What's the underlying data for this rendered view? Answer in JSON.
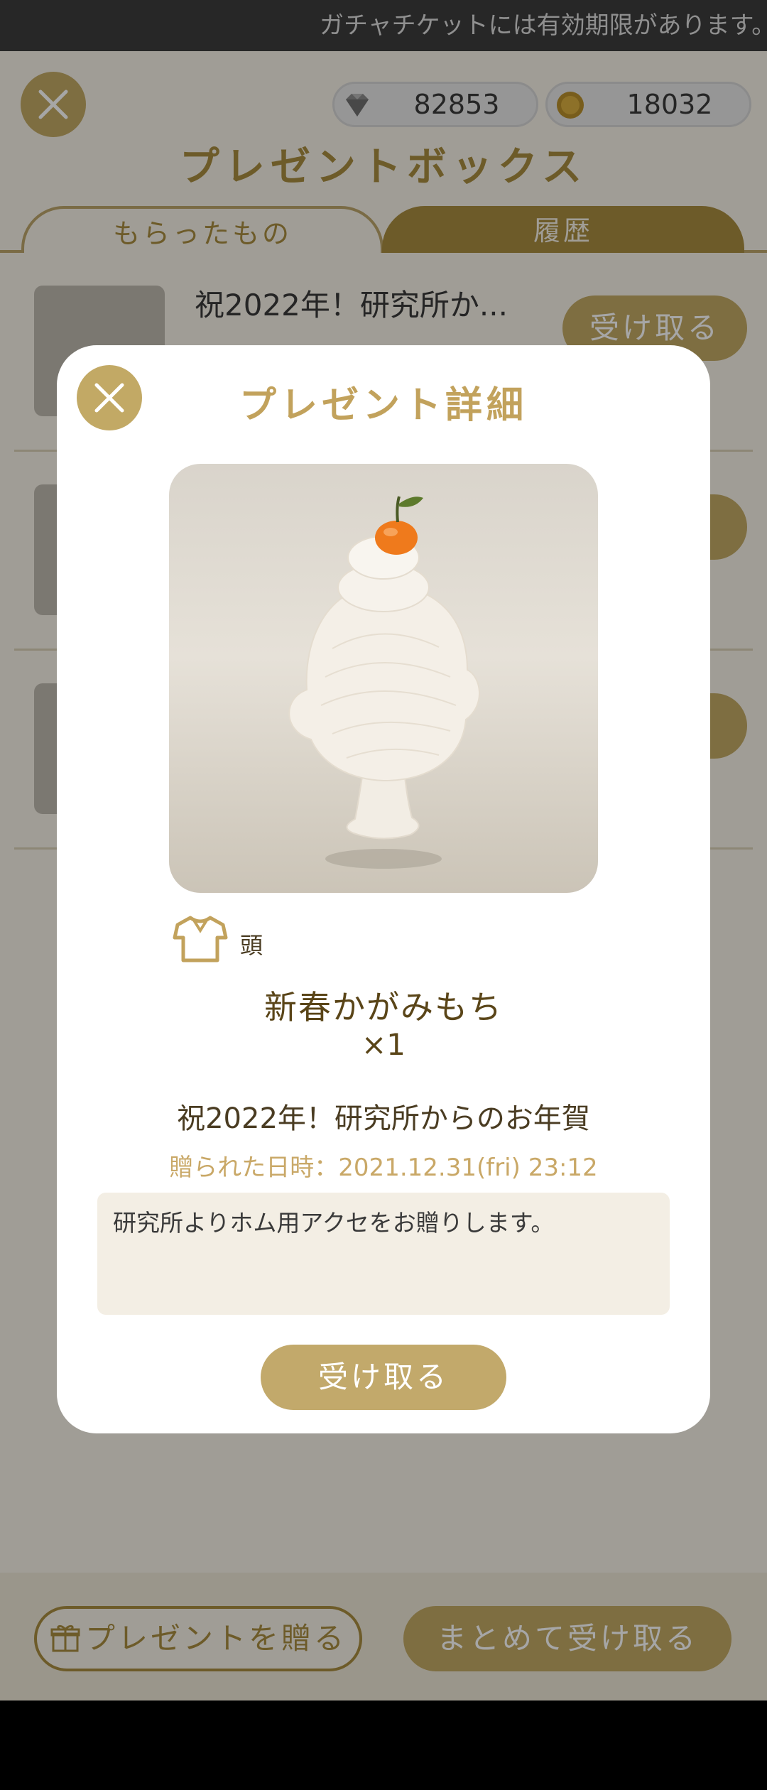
{
  "ticker": {
    "text": "ガチャチケットには有効期限があります。"
  },
  "currencies": {
    "gems": "82853",
    "coins": "18032"
  },
  "header": {
    "title": "プレゼントボックス"
  },
  "tabs": [
    {
      "label": "もらったもの"
    },
    {
      "label": "履歴"
    }
  ],
  "list": {
    "items": [
      {
        "title": "祝2022年！研究所か...",
        "button": "受け取る"
      }
    ]
  },
  "footer": {
    "gift_label": "プレゼントを贈る",
    "bulk_label": "まとめて受け取る"
  },
  "modal": {
    "title": "プレゼント詳細",
    "slot_label": "頭",
    "item_name": "新春かがみもち",
    "quantity": "×1",
    "message_title": "祝2022年！研究所からのお年賀",
    "sent_date": "贈られた日時：2021.12.31(fri) 23:12",
    "message_body": "研究所よりホム用アクセをお贈りします。",
    "receive_label": "受け取る"
  },
  "icons": {
    "close": "close-icon",
    "gem": "diamond-icon",
    "coin": "coin-icon",
    "slot": "shirt-icon",
    "gift": "gift-icon"
  },
  "colors": {
    "accent": "#c2a965",
    "accent_dark": "#a88c3f",
    "title_gold": "#c2a25c",
    "date_gold": "#c9a867"
  }
}
